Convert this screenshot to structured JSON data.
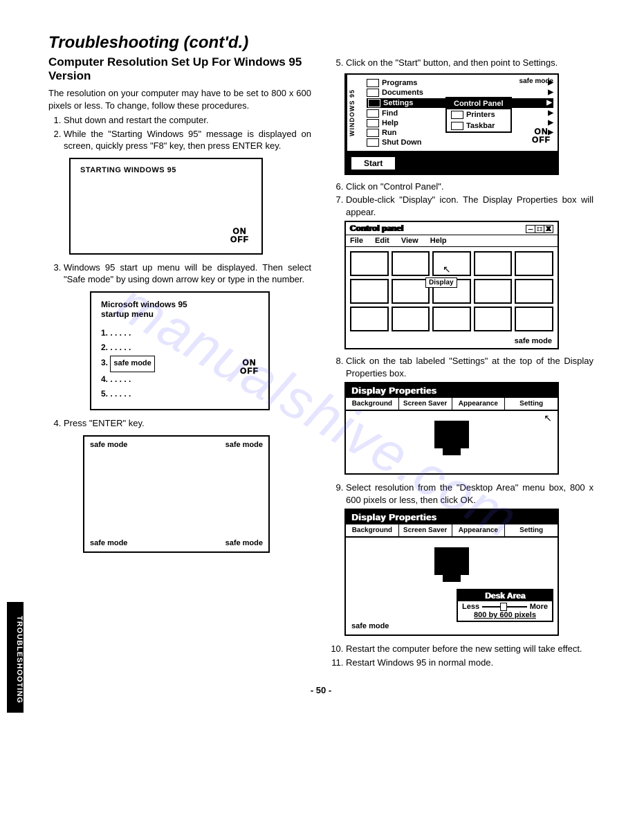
{
  "title": "Troubleshooting (cont'd.)",
  "subtitle": "Computer Resolution Set Up For Windows 95 Version",
  "intro": "The resolution on your computer may have to be set to 800 x 600 pixels or less. To change, follow these procedures.",
  "steps_left": {
    "s1": "Shut down and restart the computer.",
    "s2": "While the \"Starting Windows 95\" message is displayed on screen, quickly press \"F8\" key, then press ENTER key.",
    "s3": "Windows 95 start up menu will be displayed. Then select \"Safe mode\" by using down arrow key or type in the number.",
    "s4": "Press \"ENTER\" key."
  },
  "fig1": {
    "title": "STARTING WINDOWS 95"
  },
  "fig2": {
    "title": "Microsoft windows 95\nstartup menu",
    "items": {
      "i1": "1. . . . . .",
      "i2": "2. . . . . .",
      "i3_pre": "3.",
      "i3_box": "safe mode",
      "i4": "4. . . . . .",
      "i5": "5. . . . . ."
    }
  },
  "fig3": {
    "corner": "safe mode"
  },
  "steps_right": {
    "s5": "Click on the \"Start\" button, and then point to Settings.",
    "s6": "Click on \"Control Panel\".",
    "s7": "Double-click \"Display\" icon. The Display Properties box will appear.",
    "s8": "Click on the tab labeled \"Settings\" at the top of the Display Properties box.",
    "s9": "Select resolution from the \"Desktop Area\" menu box, 800 x 600 pixels or less, then click OK.",
    "s10": "Restart the computer before the new setting will take effect.",
    "s11": "Restart Windows 95 in normal mode."
  },
  "startmenu": {
    "brand": "WINDOWS 95",
    "items": {
      "programs": "Programs",
      "documents": "Documents",
      "settings": "Settings",
      "find": "Find",
      "help": "Help",
      "run": "Run",
      "shutdown": "Shut Down"
    },
    "sub": {
      "header": "Control Panel",
      "printers": "Printers",
      "taskbar": "Taskbar"
    },
    "safemode": "safe mode",
    "start": "Start"
  },
  "controlpanel": {
    "title": "Control panel",
    "menu": {
      "file": "File",
      "edit": "Edit",
      "view": "View",
      "help": "Help"
    },
    "display": "Display",
    "safemode": "safe mode"
  },
  "displayprops": {
    "title": "Display Properties",
    "tabs": {
      "bg": "Background",
      "ss": "Screen Saver",
      "ap": "Appearance",
      "st": "Setting"
    }
  },
  "deskarea": {
    "title": "Desk Area",
    "less": "Less",
    "more": "More",
    "res": "800 by 600 pixels",
    "safemode": "safe mode"
  },
  "onoff": {
    "on": "ON",
    "off": "OFF"
  },
  "sidetab": "TROUBLESHOOTING",
  "pagenum": "- 50 -",
  "watermark": "manualshive.com"
}
